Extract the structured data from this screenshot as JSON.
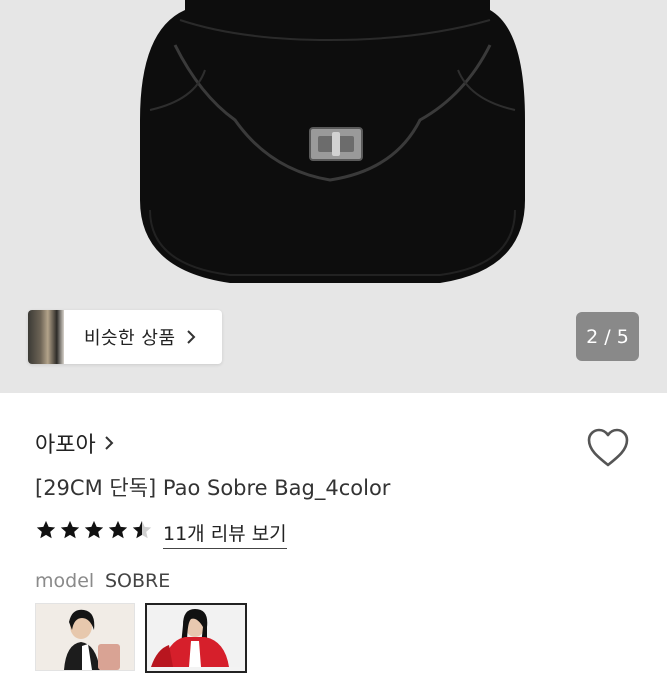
{
  "gallery": {
    "similar_products_label": "비슷한 상품",
    "counter": "2 / 5"
  },
  "product": {
    "brand": "아포아",
    "title": "[29CM 단독] Pao Sobre Bag_4color",
    "rating": 4.5,
    "rating_max": 5,
    "reviews_link": "11개 리뷰 보기"
  },
  "option": {
    "label": "model",
    "value": "SOBRE"
  },
  "colors": {
    "hero_bg": "#e6e6e6",
    "bag": "#0d0d0d",
    "counter_bg": "#7a7a7a"
  }
}
